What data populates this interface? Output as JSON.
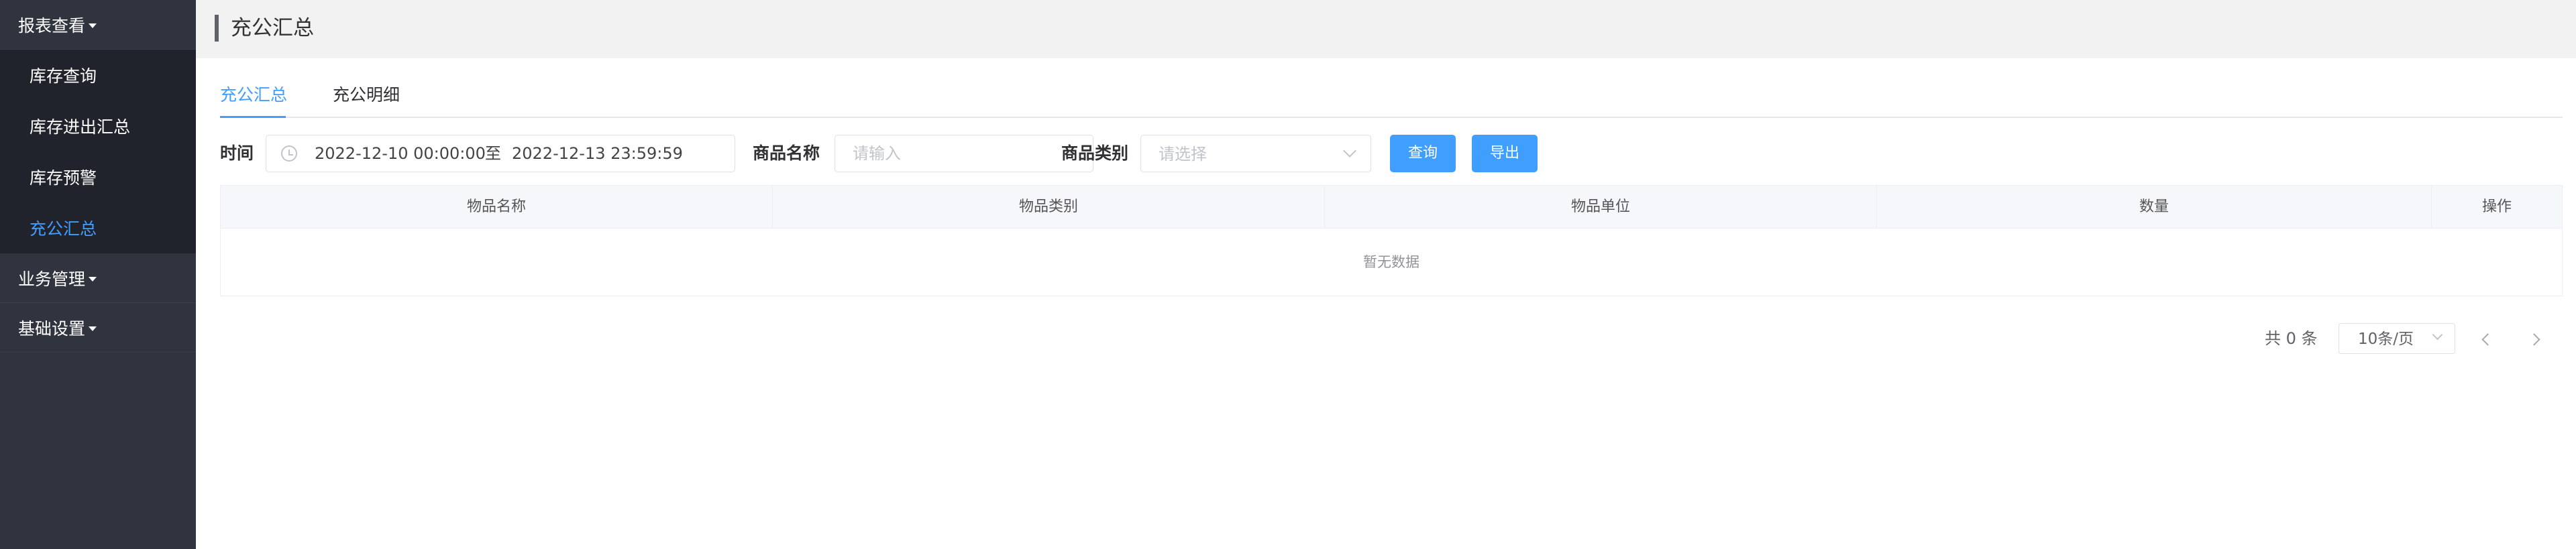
{
  "sidebar": {
    "groups": [
      {
        "label": "报表查看",
        "items": [
          "库存查询",
          "库存进出汇总",
          "库存预警",
          "充公汇总"
        ]
      },
      {
        "label": "业务管理"
      },
      {
        "label": "基础设置"
      }
    ],
    "active_item": "充公汇总"
  },
  "page": {
    "title": "充公汇总"
  },
  "tabs": [
    {
      "label": "充公汇总",
      "active": true
    },
    {
      "label": "充公明细",
      "active": false
    }
  ],
  "filters": {
    "time_label": "时间",
    "date_start": "2022-12-10 00:00:00",
    "date_separator": "至",
    "date_end": "2022-12-13 23:59:59",
    "name_label": "商品名称",
    "name_placeholder": "请输入",
    "category_label": "商品类别",
    "category_placeholder": "请选择",
    "search_button": "查询",
    "export_button": "导出"
  },
  "table": {
    "columns": [
      "物品名称",
      "物品类别",
      "物品单位",
      "数量",
      "操作"
    ],
    "rows": [],
    "empty_text": "暂无数据"
  },
  "pagination": {
    "total_text": "共 0 条",
    "page_size": "10条/页"
  },
  "colors": {
    "accent": "#409eff",
    "sidebar_bg": "#2b2f3a"
  }
}
